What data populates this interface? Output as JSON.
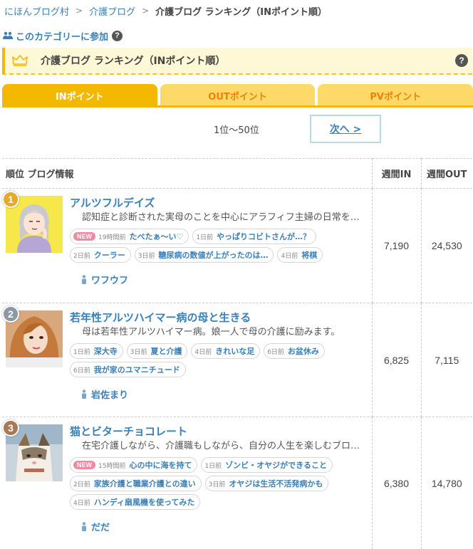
{
  "breadcrumb": {
    "home": "にほんブログ村",
    "category": "介護ブログ",
    "current": "介護ブログ ランキング（INポイント順）",
    "separator": ">"
  },
  "join": {
    "label": "このカテゴリーに参加",
    "help": "?"
  },
  "title_bar": {
    "title": "介護ブログ ランキング（INポイント順）",
    "help": "?"
  },
  "tabs": [
    {
      "label": "INポイント",
      "active": true
    },
    {
      "label": "OUTポイント",
      "active": false
    },
    {
      "label": "PVポイント",
      "active": false
    }
  ],
  "pagination": {
    "range": "1位～50位",
    "next": "次へ >"
  },
  "table": {
    "headers": {
      "info": "順位 ブログ情報",
      "weekly_in": "週間IN",
      "weekly_out": "週間OUT"
    },
    "rows": [
      {
        "rank": "1",
        "blog_name": "アルツフルデイズ",
        "description": "認知症と診断された実母のことを中心にアラフィフ主婦の日常を綴っています",
        "tags": [
          {
            "new": "NEW",
            "when": "19時間前",
            "text": "たべたぁ〜い♡"
          },
          {
            "when": "1日前",
            "text": "やっぱりコビトさんが…？"
          },
          {
            "when": "2日前",
            "text": "クーラー"
          },
          {
            "when": "3日前",
            "text": "糖尿病の数値が上がったのは…"
          },
          {
            "when": "4日前",
            "text": "将棋"
          }
        ],
        "author": "ワフウフ",
        "weekly_in": "7,190",
        "weekly_out": "24,530"
      },
      {
        "rank": "2",
        "blog_name": "若年性アルツハイマー病の母と生きる",
        "description": "母は若年性アルツハイマー病。娘一人で母の介護に励みます。",
        "tags": [
          {
            "when": "1日前",
            "text": "深大寺"
          },
          {
            "when": "3日前",
            "text": "夏と介護"
          },
          {
            "when": "4日前",
            "text": "きれいな足"
          },
          {
            "when": "6日前",
            "text": "お盆休み"
          },
          {
            "when": "6日前",
            "text": "我が家のユマニチュード"
          }
        ],
        "author": "岩佐まり",
        "weekly_in": "6,825",
        "weekly_out": "7,115"
      },
      {
        "rank": "3",
        "blog_name": "猫とビターチョコレート",
        "description": "在宅介護しながら、介護職もしながら、自分の人生を楽しむブログです",
        "tags": [
          {
            "new": "NEW",
            "when": "15時間前",
            "text": "心の中に海を持て"
          },
          {
            "when": "1日前",
            "text": "ゾンビ・オヤジができること"
          },
          {
            "when": "2日前",
            "text": "家族介護と職業介護との違い"
          },
          {
            "when": "3日前",
            "text": "オヤジは生活不活発病かも"
          },
          {
            "when": "4日前",
            "text": "ハンディ扇風機を使ってみた"
          }
        ],
        "author": "だだ",
        "weekly_in": "6,380",
        "weekly_out": "14,780"
      }
    ]
  },
  "colors": {
    "accent": "#f5b800",
    "tab_inactive": "#fdd96a",
    "link": "#3a7fb8",
    "title_bg": "#fff8d6",
    "new_badge": "#ef8ba0"
  },
  "icons": {
    "crown": "crown-icon",
    "help": "question-icon",
    "person": "person-icon"
  }
}
